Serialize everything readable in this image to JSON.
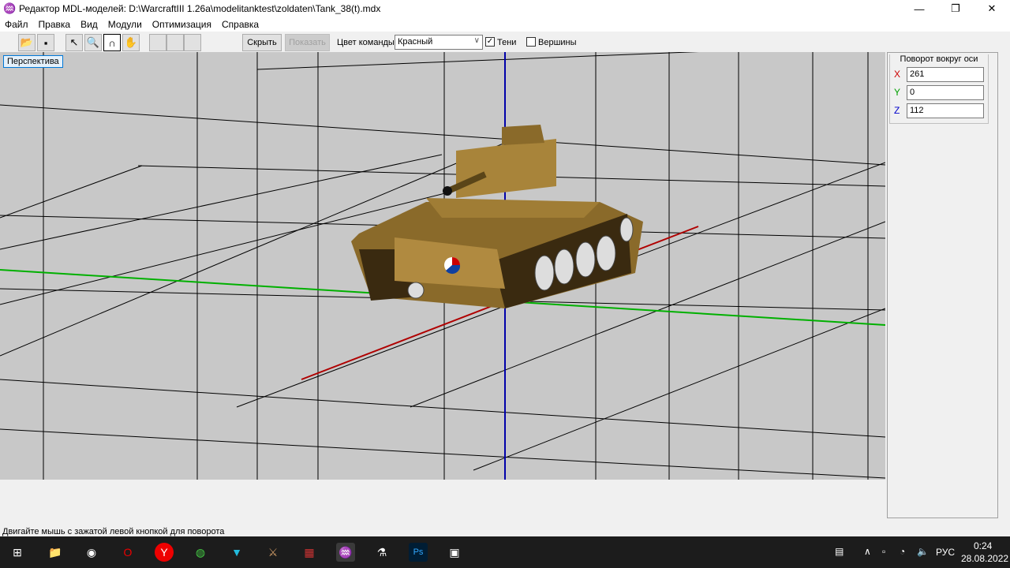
{
  "window": {
    "title": "Редактор MDL-моделей: D:\\WarcraftIII 1.26a\\modelitanktest\\zoldaten\\Tank_38(t).mdx",
    "minimize": "—",
    "restore": "❐",
    "close": "✕"
  },
  "menu": [
    "Файл",
    "Правка",
    "Вид",
    "Модули",
    "Оптимизация",
    "Справка"
  ],
  "toolbar": {
    "hide": "Скрыть",
    "show": "Показать",
    "team_color_label": "Цвет команды:",
    "team_color": "Красный",
    "shadows_label": "Тени",
    "shadows_checked": true,
    "vertices_label": "Вершины",
    "vertices_checked": false
  },
  "viewport": {
    "mode": "Перспектива"
  },
  "rotation": {
    "title": "Поворот вокруг оси",
    "x_label": "X",
    "y_label": "Y",
    "z_label": "Z",
    "x": "261",
    "y": "0",
    "z": "112"
  },
  "status": "Двигайте мышь с зажатой левой кнопкой для поворота",
  "taskbar": {
    "lang": "РУС",
    "time": "0:24",
    "date": "28.08.2022"
  },
  "colors": {
    "x_axis": "#cc0000",
    "y_axis": "#00b000",
    "z_axis": "#0000aa"
  }
}
